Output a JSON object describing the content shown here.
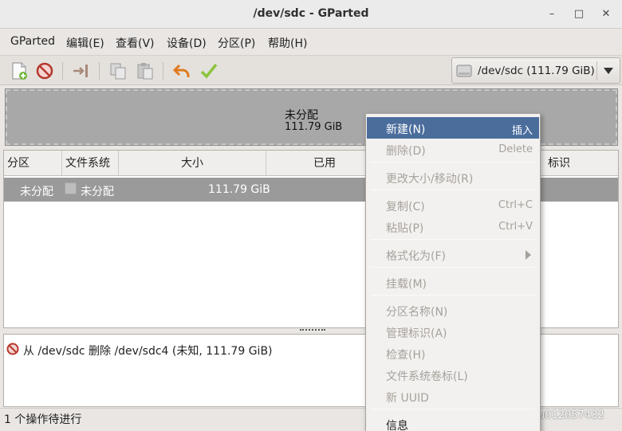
{
  "window": {
    "title": "/dev/sdc - GParted",
    "minimize": "–",
    "maximize": "□",
    "close": "✕"
  },
  "menubar": [
    "GParted",
    "编辑(E)",
    "查看(V)",
    "设备(D)",
    "分区(P)",
    "帮助(H)"
  ],
  "toolbar": {
    "icons": [
      "new-partition-icon",
      "delete-partition-icon",
      "resize-move-icon",
      "copy-icon",
      "paste-icon",
      "undo-icon",
      "apply-icon"
    ],
    "device": "/dev/sdc   (111.79 GiB)"
  },
  "diskmap": {
    "label": "未分配",
    "size": "111.79 GiB"
  },
  "table": {
    "headers": [
      "分区",
      "文件系统",
      "大小",
      "已用",
      "标识"
    ],
    "rows": [
      {
        "partition": "未分配",
        "filesystem": "未分配",
        "size": "111.79 GiB"
      }
    ]
  },
  "operations": [
    "从 /dev/sdc 删除 /dev/sdc4 (未知, 111.79 GiB)"
  ],
  "status": "1 个操作待进行",
  "context_menu": {
    "items": [
      {
        "label": "新建(N)",
        "accel": "插入",
        "state": "active"
      },
      {
        "label": "删除(D)",
        "accel": "Delete",
        "state": "disabled"
      },
      {
        "label": "更改大小/移动(R)",
        "accel": "",
        "state": "disabled"
      },
      {
        "label": "复制(C)",
        "accel": "Ctrl+C",
        "state": "disabled"
      },
      {
        "label": "粘贴(P)",
        "accel": "Ctrl+V",
        "state": "disabled"
      },
      {
        "label": "格式化为(F)",
        "accel": "",
        "state": "disabled"
      },
      {
        "label": "挂载(M)",
        "accel": "",
        "state": "disabled"
      },
      {
        "label": "分区名称(N)",
        "accel": "",
        "state": "disabled"
      },
      {
        "label": "管理标识(A)",
        "accel": "",
        "state": "disabled"
      },
      {
        "label": "检查(H)",
        "accel": "",
        "state": "disabled"
      },
      {
        "label": "文件系统卷标(L)",
        "accel": "",
        "state": "disabled"
      },
      {
        "label": "新 UUID",
        "accel": "",
        "state": "disabled"
      },
      {
        "label": "信息",
        "accel": "",
        "state": "normal"
      }
    ]
  },
  "watermark": "https://blog.csdn.net/u012057432"
}
